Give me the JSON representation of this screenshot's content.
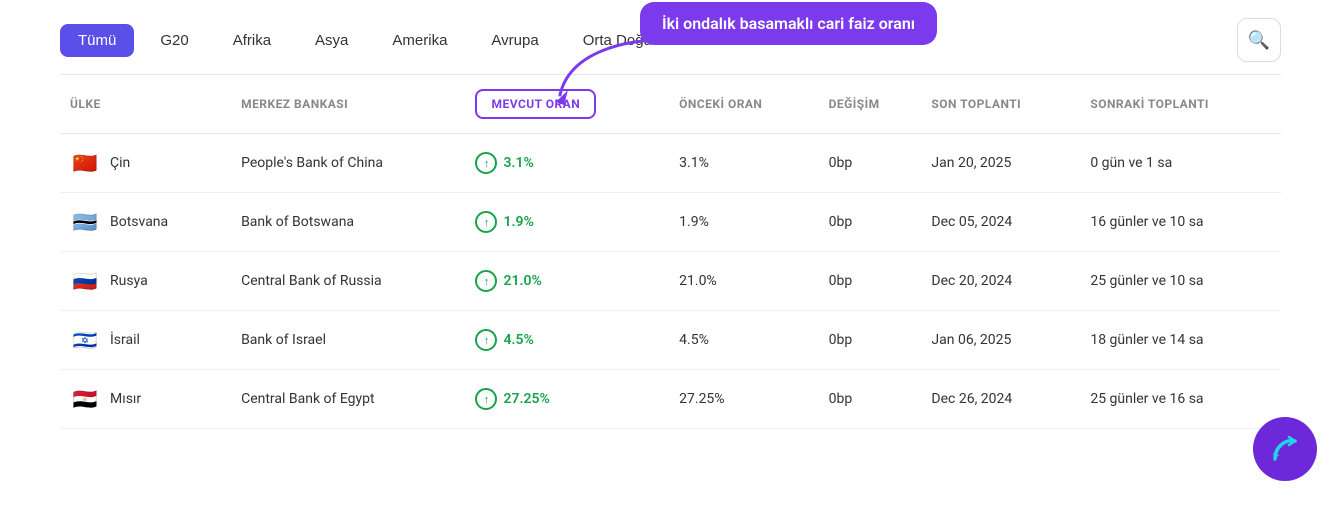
{
  "nav": {
    "buttons": [
      {
        "label": "Tümü",
        "active": true
      },
      {
        "label": "G20",
        "active": false
      },
      {
        "label": "Afrika",
        "active": false
      },
      {
        "label": "Asya",
        "active": false
      },
      {
        "label": "Amerika",
        "active": false
      },
      {
        "label": "Avrupa",
        "active": false
      },
      {
        "label": "Orta Doğu",
        "active": false
      }
    ]
  },
  "annotation": {
    "text": "İki ondalık basamaklı cari faiz oranı"
  },
  "table": {
    "columns": [
      {
        "key": "ulke",
        "label": "ÜLKE"
      },
      {
        "key": "merkez",
        "label": "MERKEZ BANKASI"
      },
      {
        "key": "mevcut",
        "label": "MEVCUT ORAN"
      },
      {
        "key": "onceki",
        "label": "ÖNCEKİ ORAN"
      },
      {
        "key": "degisim",
        "label": "DEĞİŞİM"
      },
      {
        "key": "son",
        "label": "SON TOPLANTI"
      },
      {
        "key": "sonraki",
        "label": "SONRAKİ TOPLANTI"
      }
    ],
    "rows": [
      {
        "flag": "🇨🇳",
        "country": "Çin",
        "bank": "People's Bank of China",
        "mevcut": "3.1%",
        "onceki": "3.1%",
        "degisim": "0bp",
        "son": "Jan 20, 2025",
        "sonraki": "0 gün ve 1 sa"
      },
      {
        "flag": "🇧🇼",
        "country": "Botsvana",
        "bank": "Bank of Botswana",
        "mevcut": "1.9%",
        "onceki": "1.9%",
        "degisim": "0bp",
        "son": "Dec 05, 2024",
        "sonraki": "16 günler ve 10 sa"
      },
      {
        "flag": "🇷🇺",
        "country": "Rusya",
        "bank": "Central Bank of Russia",
        "mevcut": "21.0%",
        "onceki": "21.0%",
        "degisim": "0bp",
        "son": "Dec 20, 2024",
        "sonraki": "25 günler ve 10 sa"
      },
      {
        "flag": "🇮🇱",
        "country": "İsrail",
        "bank": "Bank of Israel",
        "mevcut": "4.5%",
        "onceki": "4.5%",
        "degisim": "0bp",
        "son": "Jan 06, 2025",
        "sonraki": "18 günler ve 14 sa"
      },
      {
        "flag": "🇪🇬",
        "country": "Mısır",
        "bank": "Central Bank of Egypt",
        "mevcut": "27.25%",
        "onceki": "27.25%",
        "degisim": "0bp",
        "son": "Dec 26, 2024",
        "sonraki": "25 günler ve 16 sa"
      }
    ]
  },
  "logo": "↺"
}
